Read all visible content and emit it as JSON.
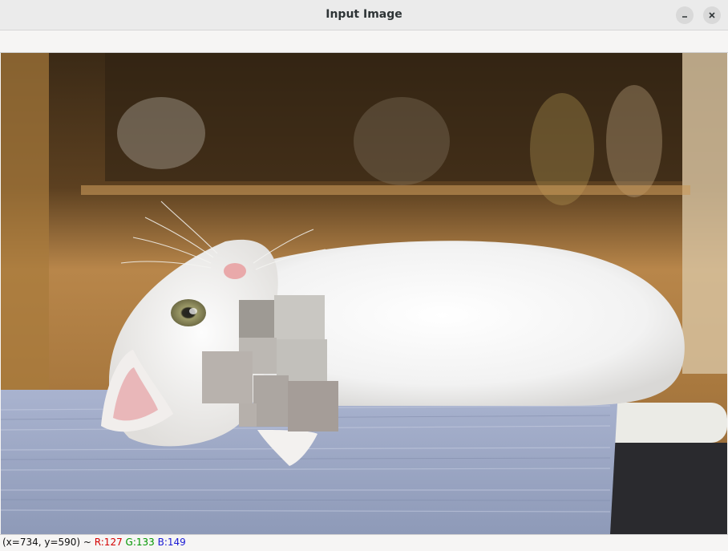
{
  "window": {
    "title": "Input Image",
    "controls": [
      {
        "name": "minimize",
        "icon": "minimize-icon"
      },
      {
        "name": "close",
        "icon": "close-icon"
      }
    ]
  },
  "canvas": {
    "image_description_icon": "cat-photo"
  },
  "status": {
    "coords": "(x=734, y=590) ~ ",
    "r": "R:127",
    "g": "G:133",
    "b": "B:149"
  }
}
